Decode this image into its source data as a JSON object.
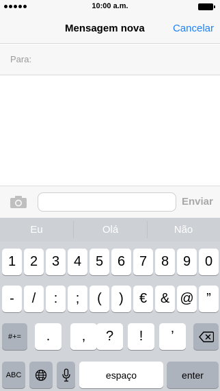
{
  "status_bar": {
    "time": "10:00 a.m."
  },
  "nav": {
    "title": "Mensagem nova",
    "cancel": "Cancelar"
  },
  "recipient": {
    "label": "Para:"
  },
  "compose_bar": {
    "send": "Enviar",
    "input_value": ""
  },
  "predictions": [
    "Eu",
    "Olá",
    "Não"
  ],
  "keyboard": {
    "row1": [
      "1",
      "2",
      "3",
      "4",
      "5",
      "6",
      "7",
      "8",
      "9",
      "0"
    ],
    "row2": [
      "-",
      "/",
      ":",
      ";",
      "(",
      ")",
      "€",
      "&",
      "@",
      "”"
    ],
    "row3": {
      "switch": "#+=",
      "keys": [
        ".",
        ",",
        "?",
        "!",
        "’"
      ],
      "delete_icon": "delete-backspace-icon"
    },
    "row4": {
      "abc": "ABC",
      "globe_icon": "globe-icon",
      "mic_icon": "microphone-icon",
      "space": "espaço",
      "enter": "enter"
    }
  }
}
